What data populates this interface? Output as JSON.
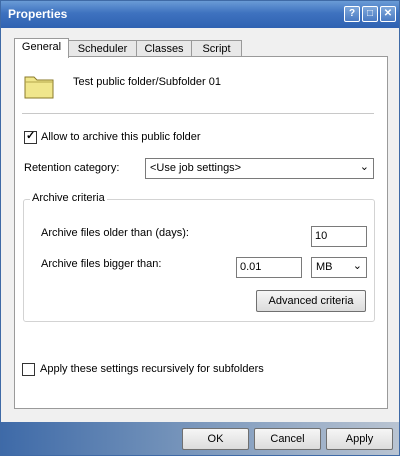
{
  "window": {
    "title": "Properties",
    "controls": {
      "help": "?",
      "maximize": "□",
      "close": "✕"
    }
  },
  "tabs": [
    {
      "label": "General",
      "active": true
    },
    {
      "label": "Scheduler",
      "active": false
    },
    {
      "label": "Classes",
      "active": false
    },
    {
      "label": "Script",
      "active": false
    }
  ],
  "general": {
    "folder_path": "Test public folder/Subfolder 01",
    "allow_archive_label": "Allow to archive this public folder",
    "allow_archive_checked": true,
    "retention_label": "Retention category:",
    "retention_value": "<Use job settings>",
    "archive_criteria": {
      "title": "Archive criteria",
      "older_than_label": "Archive files older than (days):",
      "older_than_value": "10",
      "bigger_than_label": "Archive files bigger than:",
      "bigger_than_value": "0.01",
      "size_unit": "MB",
      "advanced_button": "Advanced criteria"
    },
    "recursive_label": "Apply these settings recursively for subfolders",
    "recursive_checked": false
  },
  "footer": {
    "ok": "OK",
    "cancel": "Cancel",
    "apply": "Apply"
  },
  "icons": {
    "folder": "folder-icon",
    "dropdown": "chevron-down-icon",
    "check": "checkmark-icon"
  },
  "colors": {
    "titlebar": "#3e72bf",
    "folder": "#f0e68c"
  }
}
